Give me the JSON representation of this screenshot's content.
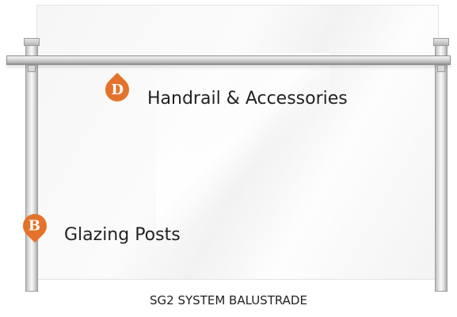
{
  "markers": {
    "handrail": {
      "letter": "D",
      "label": "Handrail & Accessories",
      "color": "#e5722b"
    },
    "glazing_posts": {
      "letter": "B",
      "label": "Glazing Posts",
      "color": "#e5722b"
    }
  },
  "caption": "SG2 SYSTEM BALUSTRADE"
}
